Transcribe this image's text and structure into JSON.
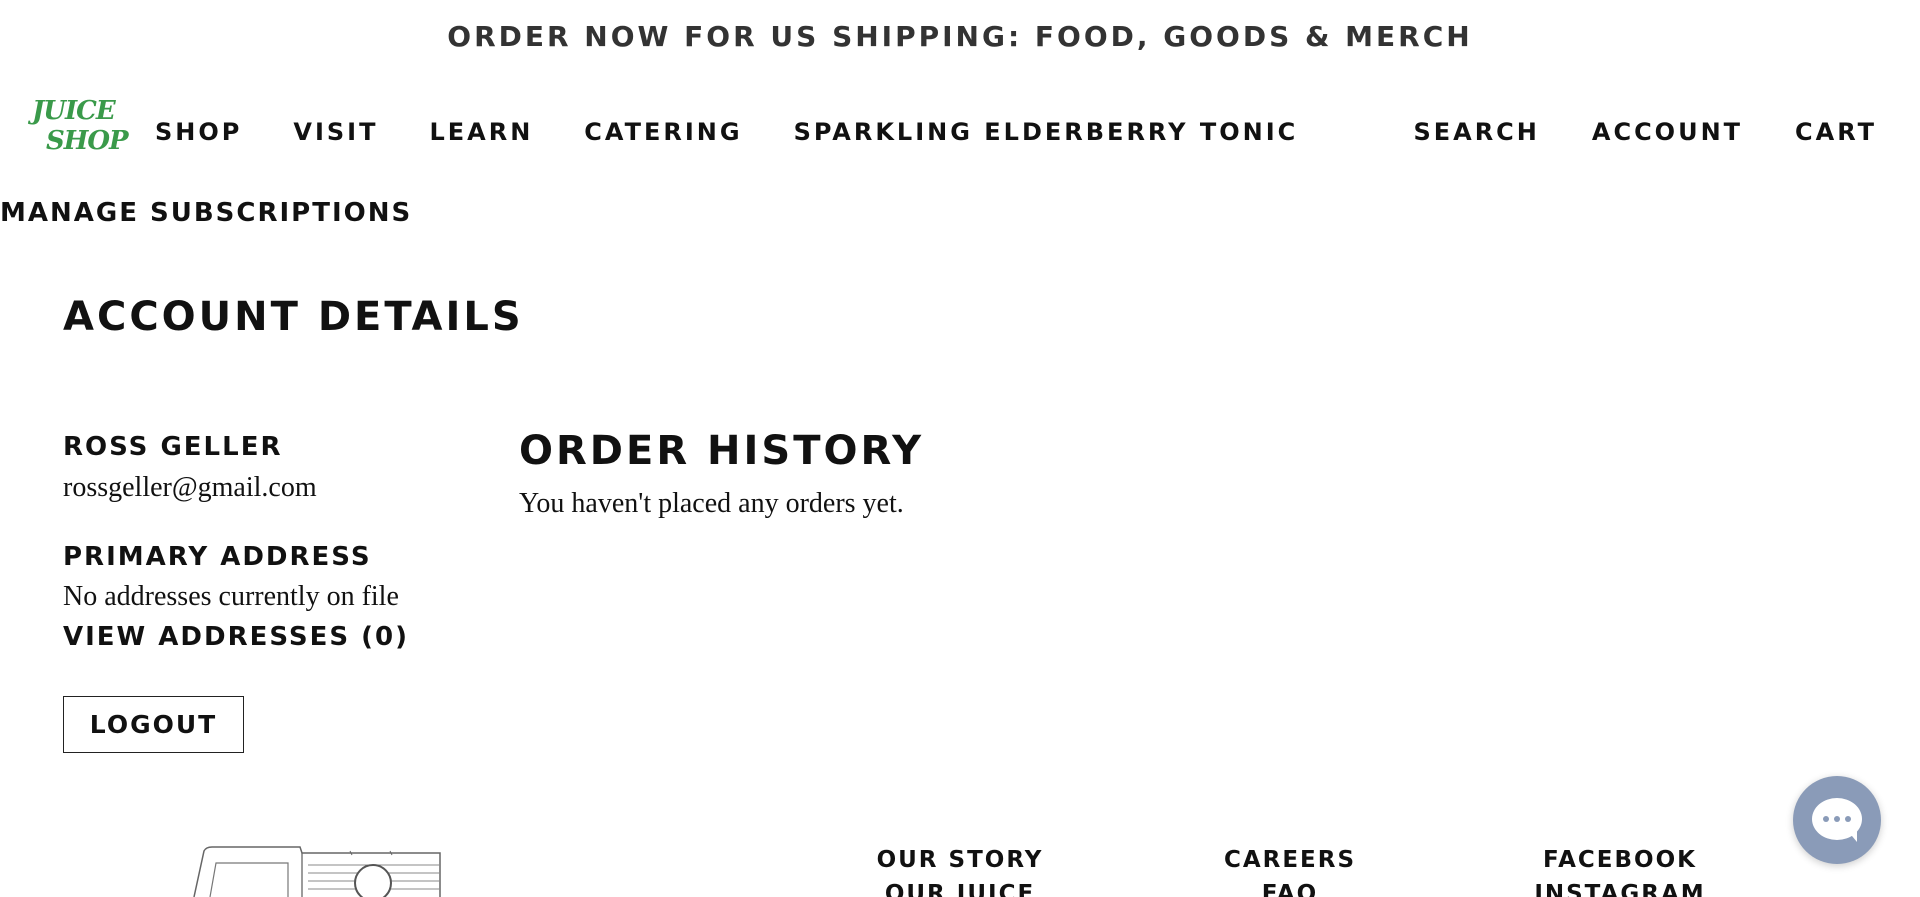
{
  "announcement": "ORDER NOW FOR US SHIPPING: FOOD, GOODS & MERCH",
  "logo": {
    "line1": "JUICE",
    "line2": "SHOP",
    "color": "#3a9a4a"
  },
  "nav": {
    "left": [
      "SHOP",
      "VISIT",
      "LEARN",
      "CATERING",
      "SPARKLING ELDERBERRY TONIC"
    ],
    "right": [
      "SEARCH",
      "ACCOUNT",
      "CART"
    ],
    "manage": "MANAGE SUBSCRIPTIONS"
  },
  "page_title": "ACCOUNT DETAILS",
  "customer": {
    "name": "ROSS GELLER",
    "email": "rossgeller@gmail.com",
    "address_label": "PRIMARY ADDRESS",
    "address_value": "No addresses currently on file",
    "view_addresses": "VIEW ADDRESSES (0)",
    "logout": "LOGOUT"
  },
  "orders": {
    "title": "ORDER HISTORY",
    "empty": "You haven't placed any orders yet."
  },
  "footer": {
    "col1": [
      "OUR STORY",
      "OUR JUICE"
    ],
    "col2": [
      "CAREERS",
      "FAQ"
    ],
    "col3": [
      "FACEBOOK",
      "INSTAGRAM"
    ]
  },
  "chat": {
    "icon": "chat-bubble-icon",
    "color": "#8a9bb8"
  }
}
